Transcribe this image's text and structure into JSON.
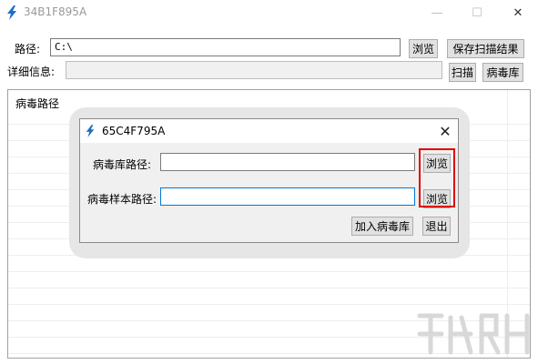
{
  "window": {
    "title": "34B1F895A",
    "icon": "lightning-icon",
    "controls": {
      "minimize": "—",
      "maximize": "☐",
      "close": "✕"
    }
  },
  "main": {
    "path_label": "路径:",
    "path_value": "C:\\",
    "browse_label": "浏览",
    "save_label": "保存扫描结果",
    "detail_label": "详细信息:",
    "detail_value": "",
    "scan_label": "扫描",
    "virus_lib_label": "病毒库"
  },
  "list": {
    "header": "病毒路径",
    "rows": []
  },
  "dialog": {
    "title": "65C4F795A",
    "close": "✕",
    "lib_path_label": "病毒库路径:",
    "lib_path_value": "",
    "sample_path_label": "病毒样本路径:",
    "sample_path_value": "",
    "browse1_label": "浏览",
    "browse2_label": "浏览",
    "add_label": "加入病毒库",
    "exit_label": "退出"
  },
  "colors": {
    "accent_focus": "#0078d7",
    "highlight": "#e00000",
    "icon_blue": "#1a6fc9"
  }
}
